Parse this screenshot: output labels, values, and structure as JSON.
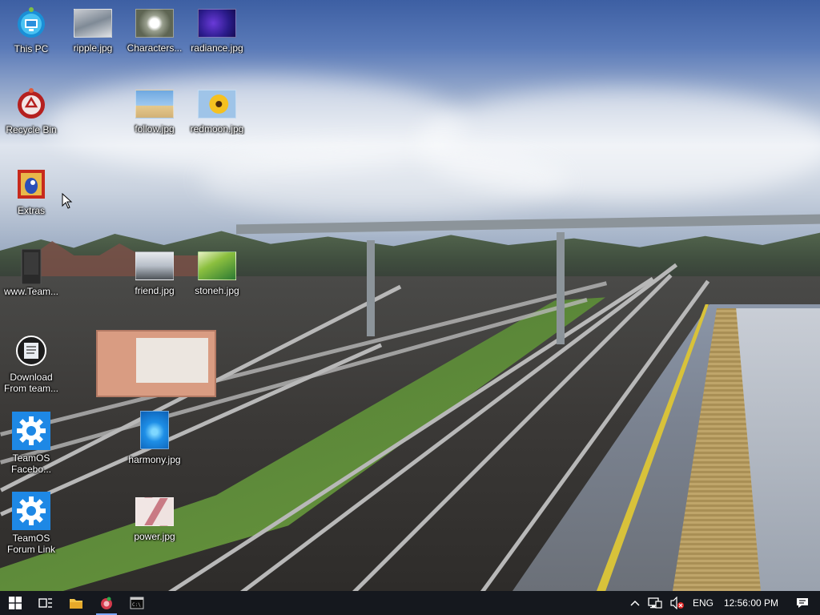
{
  "desktop": {
    "icons": [
      {
        "label": "This PC",
        "icon": "this-pc-icon"
      },
      {
        "label": "ripple.jpg",
        "icon": "image-file-icon"
      },
      {
        "label": "Characters...",
        "icon": "image-file-icon"
      },
      {
        "label": "radiance.jpg",
        "icon": "image-file-icon"
      },
      {
        "label": "Recycle Bin",
        "icon": "recycle-bin-icon"
      },
      {
        "label": "follow.jpg",
        "icon": "image-file-icon"
      },
      {
        "label": "redmoon.jpg",
        "icon": "image-file-icon"
      },
      {
        "label": "Extras",
        "icon": "extras-folder-icon"
      },
      {
        "label": "www.Team...",
        "icon": "shortcut-icon"
      },
      {
        "label": "friend.jpg",
        "icon": "image-file-icon"
      },
      {
        "label": "stoneh.jpg",
        "icon": "image-file-icon"
      },
      {
        "label": "Download From team...",
        "icon": "download-icon"
      },
      {
        "label": "TeamOS Facebo...",
        "icon": "gear-icon"
      },
      {
        "label": "harmony.jpg",
        "icon": "image-file-icon"
      },
      {
        "label": "TeamOS Forum Link",
        "icon": "gear-icon"
      },
      {
        "label": "power.jpg",
        "icon": "image-file-icon"
      }
    ]
  },
  "taskbar": {
    "start_icon": "windows-start-icon",
    "task_view_icon": "task-view-icon",
    "pinned": [
      {
        "name": "file-explorer-icon",
        "active": false
      },
      {
        "name": "app-icon",
        "active": true
      },
      {
        "name": "command-prompt-icon",
        "active": false
      }
    ],
    "tray": {
      "chevron_icon": "chevron-up-icon",
      "network_icon": "network-icon",
      "volume_icon": "volume-muted-icon",
      "language": "ENG",
      "clock": "12:56:00 PM",
      "notifications_icon": "notifications-icon"
    }
  },
  "colors": {
    "taskbar_bg": "#101216",
    "accent": "#1e90ff",
    "label_text": "#ffffff"
  }
}
